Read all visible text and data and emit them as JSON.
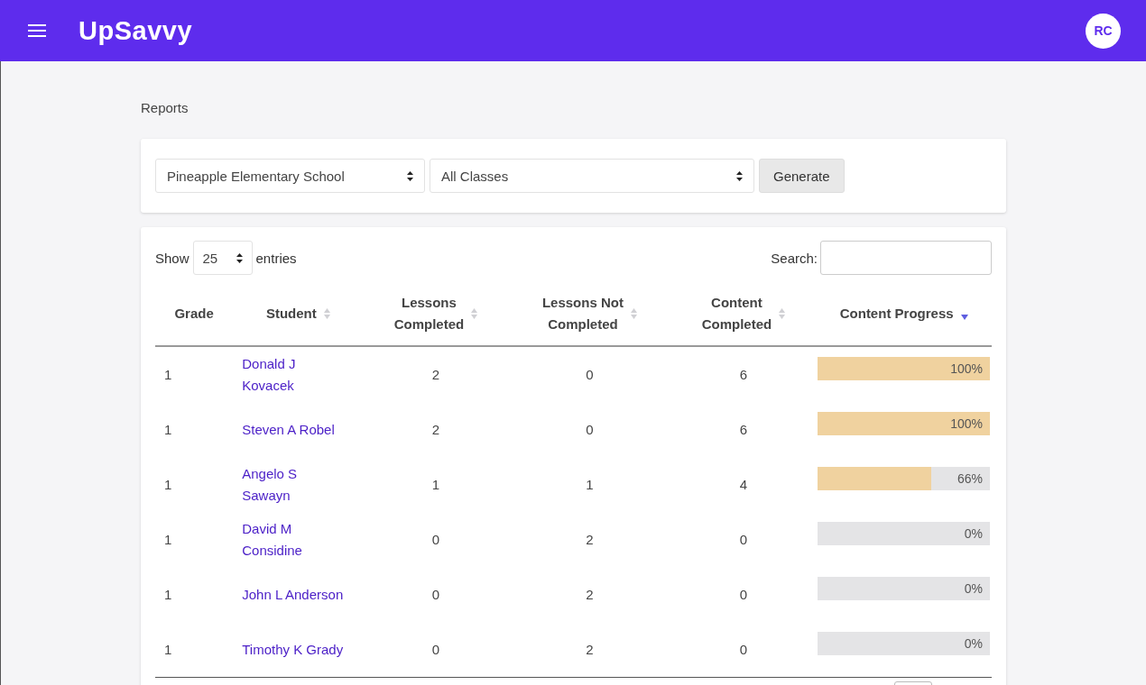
{
  "header": {
    "brand": "UpSavvy",
    "avatar": "RC"
  },
  "page_title": "Reports",
  "filters": {
    "school": "Pineapple Elementary School",
    "classes": "All Classes",
    "button": "Generate"
  },
  "table_controls": {
    "show_label": "Show",
    "page_size": "25",
    "entries_label": "entries",
    "search_label": "Search:"
  },
  "table": {
    "columns": [
      {
        "label": "Grade",
        "sortable": false,
        "selected": false
      },
      {
        "label": "Student",
        "sortable": true,
        "selected": false
      },
      {
        "label": "Lessons\nCompleted",
        "sortable": true,
        "selected": false
      },
      {
        "label": "Lessons Not\nCompleted",
        "sortable": true,
        "selected": false
      },
      {
        "label": "Content\nCompleted",
        "sortable": true,
        "selected": false
      },
      {
        "label": "Content Progress",
        "sortable": true,
        "selected": true
      }
    ],
    "rows": [
      {
        "grade": "1",
        "student": "Donald J\nKovacek",
        "lessons_completed": "2",
        "lessons_not_completed": "0",
        "content_completed": "6",
        "level": 1,
        "progress": "100%"
      },
      {
        "grade": "1",
        "student": "Steven A Robel",
        "lessons_completed": "2",
        "lessons_not_completed": "0",
        "content_completed": "6",
        "level": 1,
        "progress": "100%"
      },
      {
        "grade": "1",
        "student": "Angelo S\nSawayn",
        "lessons_completed": "1",
        "lessons_not_completed": "1",
        "content_completed": "4",
        "level": 0.66,
        "progress": "66%"
      },
      {
        "grade": "1",
        "student": "David M\nConsidine",
        "lessons_completed": "0",
        "lessons_not_completed": "2",
        "content_completed": "0",
        "level": 0,
        "progress": "0%"
      },
      {
        "grade": "1",
        "student": "John L Anderson",
        "lessons_completed": "0",
        "lessons_not_completed": "2",
        "content_completed": "0",
        "level": 0,
        "progress": "0%"
      },
      {
        "grade": "1",
        "student": "Timothy K Grady",
        "lessons_completed": "0",
        "lessons_not_completed": "2",
        "content_completed": "0",
        "level": 0,
        "progress": "0%"
      }
    ]
  }
}
